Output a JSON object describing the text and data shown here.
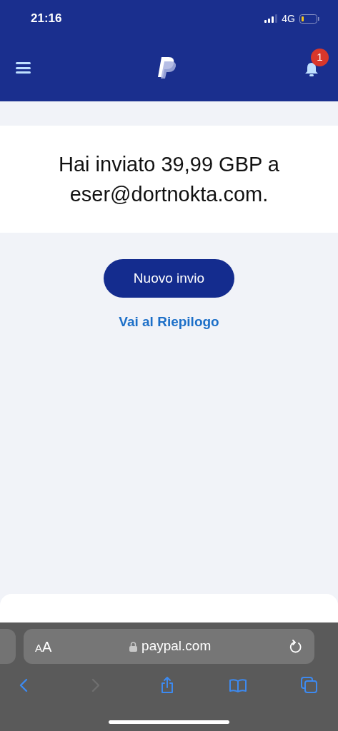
{
  "status_bar": {
    "time": "21:16",
    "network": "4G"
  },
  "header": {
    "notification_count": "1"
  },
  "message": "Hai inviato 39,99 GBP a eser@dortnokta.com.",
  "primary_button": "Nuovo invio",
  "summary_link": "Vai al Riepilogo",
  "browser": {
    "text_size_label": "AA",
    "url": "paypal.com",
    "toolbar": [
      {
        "kind": "back",
        "disabled": false
      },
      {
        "kind": "forward",
        "disabled": true
      },
      {
        "kind": "share",
        "disabled": false
      },
      {
        "kind": "bookmarks",
        "disabled": false
      },
      {
        "kind": "tabs",
        "disabled": false
      }
    ]
  }
}
